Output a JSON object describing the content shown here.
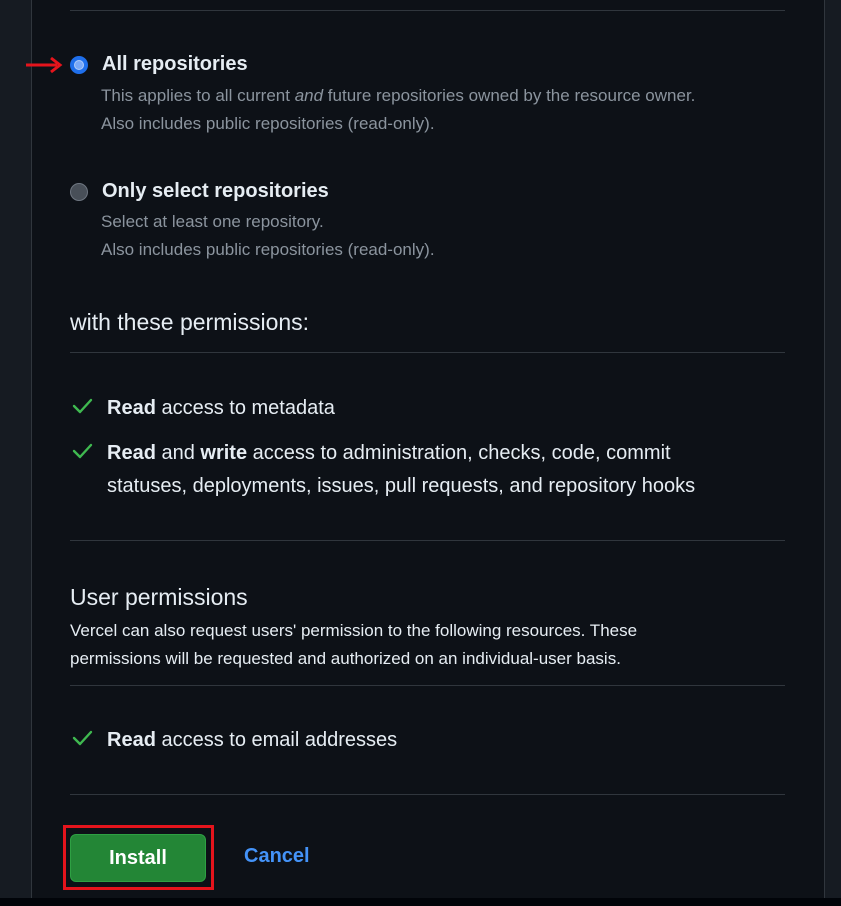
{
  "repository_access": {
    "all_option": {
      "title": "All repositories",
      "desc_before": "This applies to all current ",
      "desc_emphasis": "and",
      "desc_after": " future repositories owned by the resource owner.",
      "desc_line2": "Also includes public repositories (read-only).",
      "selected": true
    },
    "select_option": {
      "title": "Only select repositories",
      "desc_line1": "Select at least one repository.",
      "desc_line2": "Also includes public repositories (read-only).",
      "selected": false
    }
  },
  "repo_permissions": {
    "heading": "with these permissions:",
    "items": [
      {
        "bold1": "Read",
        "text1": " access to metadata"
      },
      {
        "bold1": "Read",
        "text1": " and ",
        "bold2": "write",
        "text2": " access to administration, checks, code, commit",
        "line2": "statuses, deployments, issues, pull requests, and repository hooks"
      }
    ]
  },
  "user_permissions": {
    "heading": "User permissions",
    "desc_line1": "Vercel can also request users' permission to the following resources. These",
    "desc_line2": "permissions will be requested and authorized on an individual-user basis.",
    "items": [
      {
        "bold1": "Read",
        "text1": " access to email addresses"
      }
    ]
  },
  "actions": {
    "install_label": "Install",
    "cancel_label": "Cancel"
  },
  "colors": {
    "install_bg": "#238636",
    "cancel_link": "#4493f8",
    "check": "#3fb950",
    "annotation_red": "#e5141c"
  },
  "icons": {
    "check": "check-icon",
    "arrow": "red-arrow-icon"
  }
}
